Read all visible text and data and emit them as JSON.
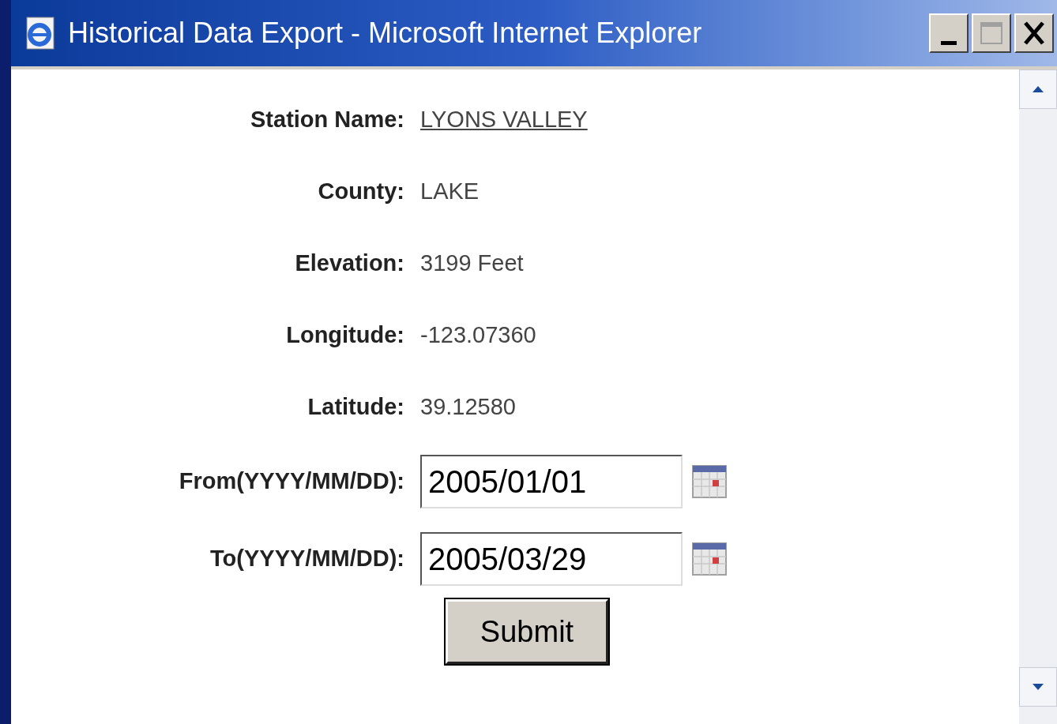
{
  "window": {
    "title": "Historical Data Export - Microsoft Internet Explorer"
  },
  "fields": [
    {
      "label": "Station Name:",
      "kind": "link",
      "value": "LYONS VALLEY"
    },
    {
      "label": "County:",
      "kind": "text",
      "value": "LAKE"
    },
    {
      "label": "Elevation:",
      "kind": "text",
      "value": "3199 Feet"
    },
    {
      "label": "Longitude:",
      "kind": "text",
      "value": "-123.07360"
    },
    {
      "label": "Latitude:",
      "kind": "text",
      "value": "39.12580"
    },
    {
      "label": "From(YYYY/MM/DD):",
      "kind": "date",
      "value": "2005/01/01"
    },
    {
      "label": "To(YYYY/MM/DD):",
      "kind": "date",
      "value": "2005/03/29"
    }
  ],
  "submit": "Submit"
}
